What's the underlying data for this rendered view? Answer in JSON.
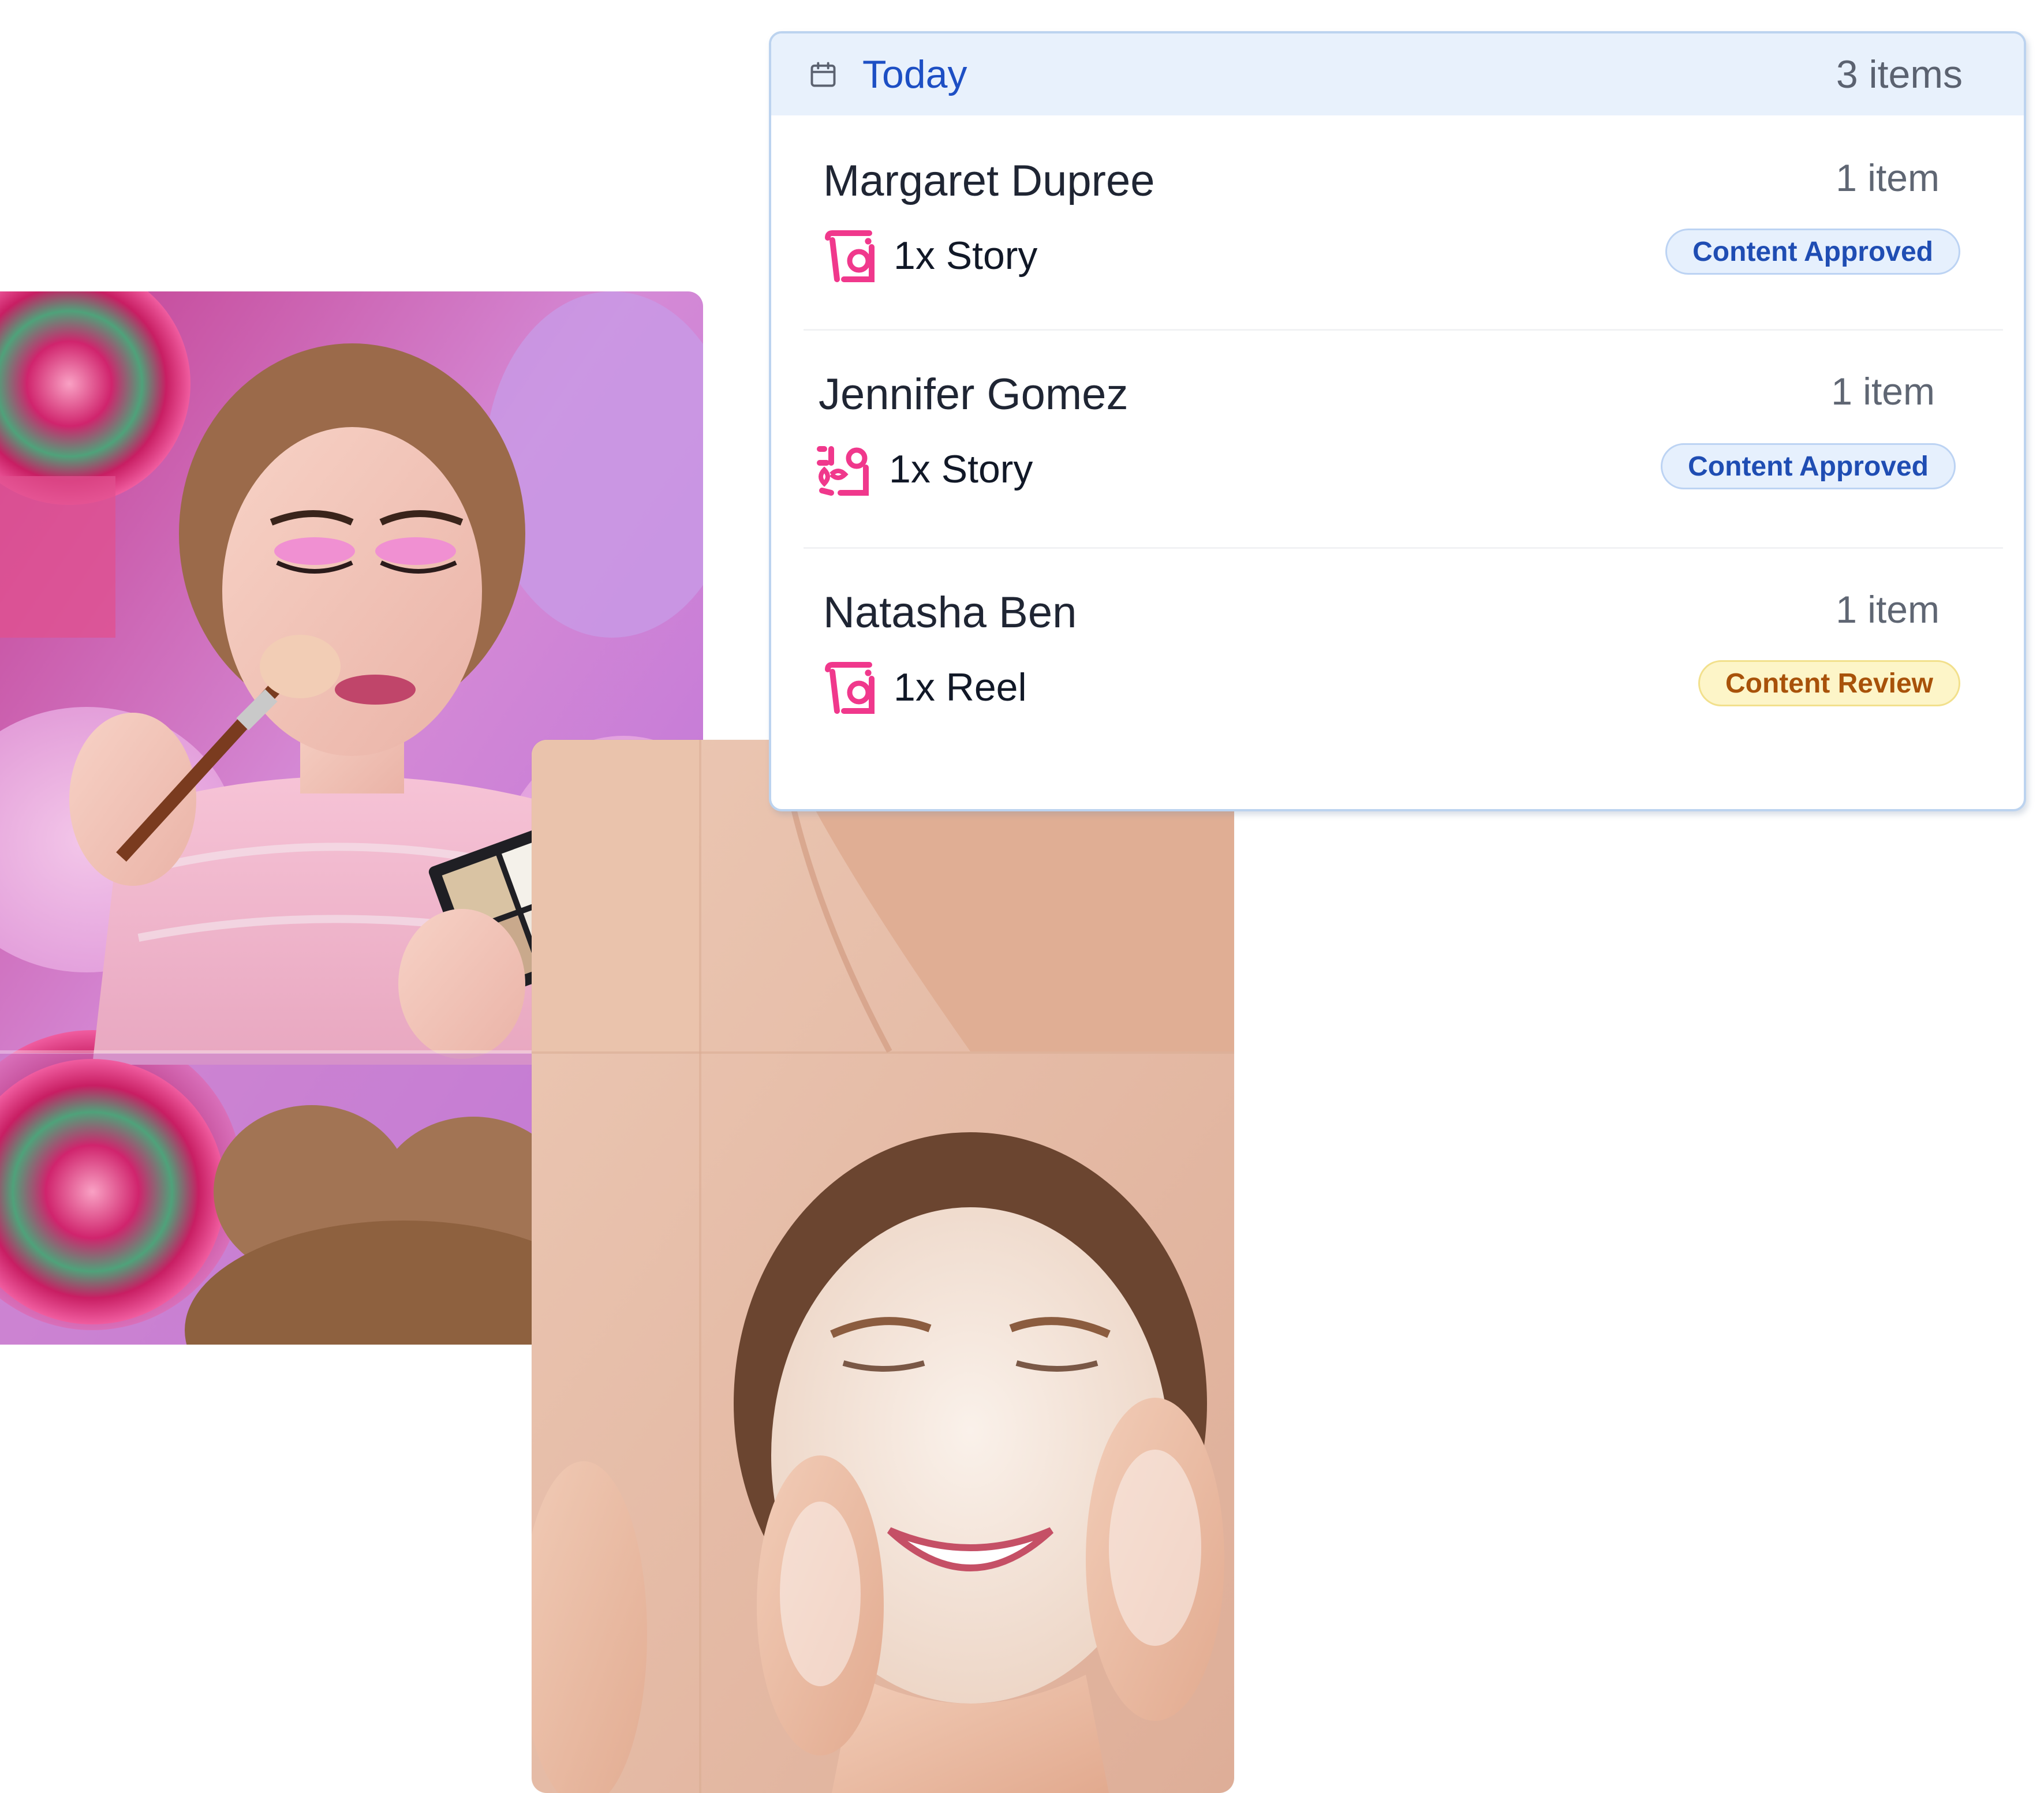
{
  "schedule": {
    "header": {
      "title": "Today",
      "count": "3 items"
    },
    "entries": [
      {
        "name": "Margaret Dupree",
        "count": "1 item",
        "content": "1x Story",
        "icon": "instagram-icon",
        "status": "Content Approved",
        "status_type": "approved"
      },
      {
        "name": "Jennifer Gomez",
        "count": "1 item",
        "content": "1x Story",
        "icon": "instagram-icon",
        "status": "Content Approved",
        "status_type": "approved"
      },
      {
        "name": "Natasha Ben",
        "count": "1 item",
        "content": "1x Reel",
        "icon": "instagram-icon",
        "status": "Content Review",
        "status_type": "review"
      }
    ]
  },
  "colors": {
    "accent_blue": "#1d4fc4",
    "approved_badge": "#e6f0fd",
    "review_badge": "#fdf5c8",
    "instagram_pink": "#f0388c"
  }
}
